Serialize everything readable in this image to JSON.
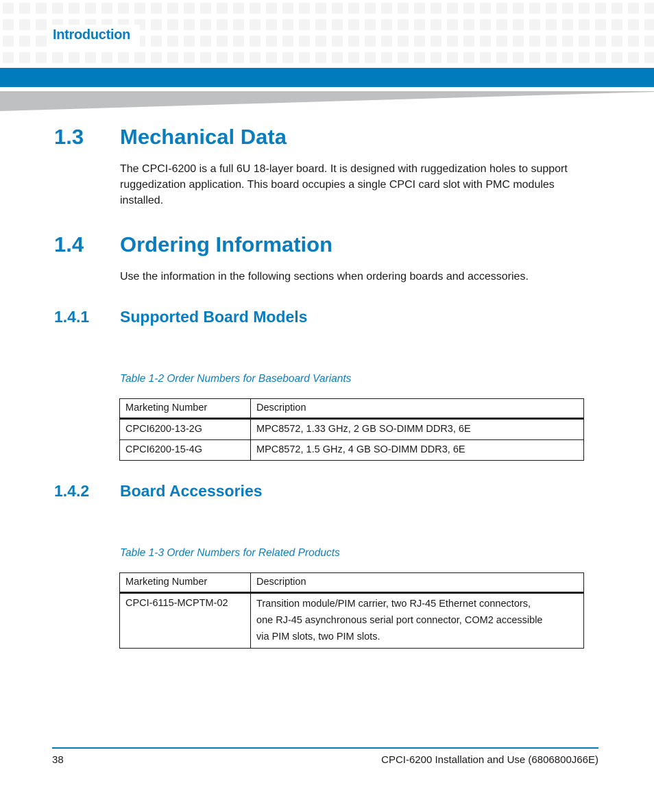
{
  "header": {
    "chapter": "Introduction",
    "accent_color": "#007cbd",
    "heading_color": "#0a7dbf"
  },
  "sections": {
    "s1_3": {
      "number": "1.3",
      "title": "Mechanical Data",
      "body": "The CPCI-6200 is a full 6U 18-layer board. It is designed with ruggedization holes to support ruggedization application. This board occupies a single CPCI card slot with PMC modules installed."
    },
    "s1_4": {
      "number": "1.4",
      "title": "Ordering Information",
      "body": "Use the information in the following sections when ordering boards and accessories."
    },
    "s1_4_1": {
      "number": "1.4.1",
      "title": "Supported Board Models"
    },
    "s1_4_2": {
      "number": "1.4.2",
      "title": "Board Accessories"
    }
  },
  "tables": {
    "baseboard": {
      "caption": "Table 1-2 Order Numbers for Baseboard Variants",
      "headers": [
        "Marketing Number",
        "Description"
      ],
      "rows": [
        [
          "CPCI6200-13-2G",
          "MPC8572, 1.33 GHz, 2 GB SO-DIMM DDR3, 6E"
        ],
        [
          "CPCI6200-15-4G",
          "MPC8572, 1.5 GHz, 4 GB SO-DIMM DDR3, 6E"
        ]
      ]
    },
    "related": {
      "caption": "Table 1-3 Order Numbers for Related Products",
      "headers": [
        "Marketing Number",
        "Description"
      ],
      "rows": [
        [
          "CPCI-6115-MCPTM-02",
          [
            "Transition module/PIM carrier, two RJ-45 Ethernet connectors,",
            "one RJ-45 asynchronous serial port connector, COM2 accessible",
            "via PIM slots, two PIM slots."
          ]
        ]
      ]
    }
  },
  "footer": {
    "page_number": "38",
    "doc_title": "CPCI-6200 Installation and Use (6806800J66E)"
  }
}
